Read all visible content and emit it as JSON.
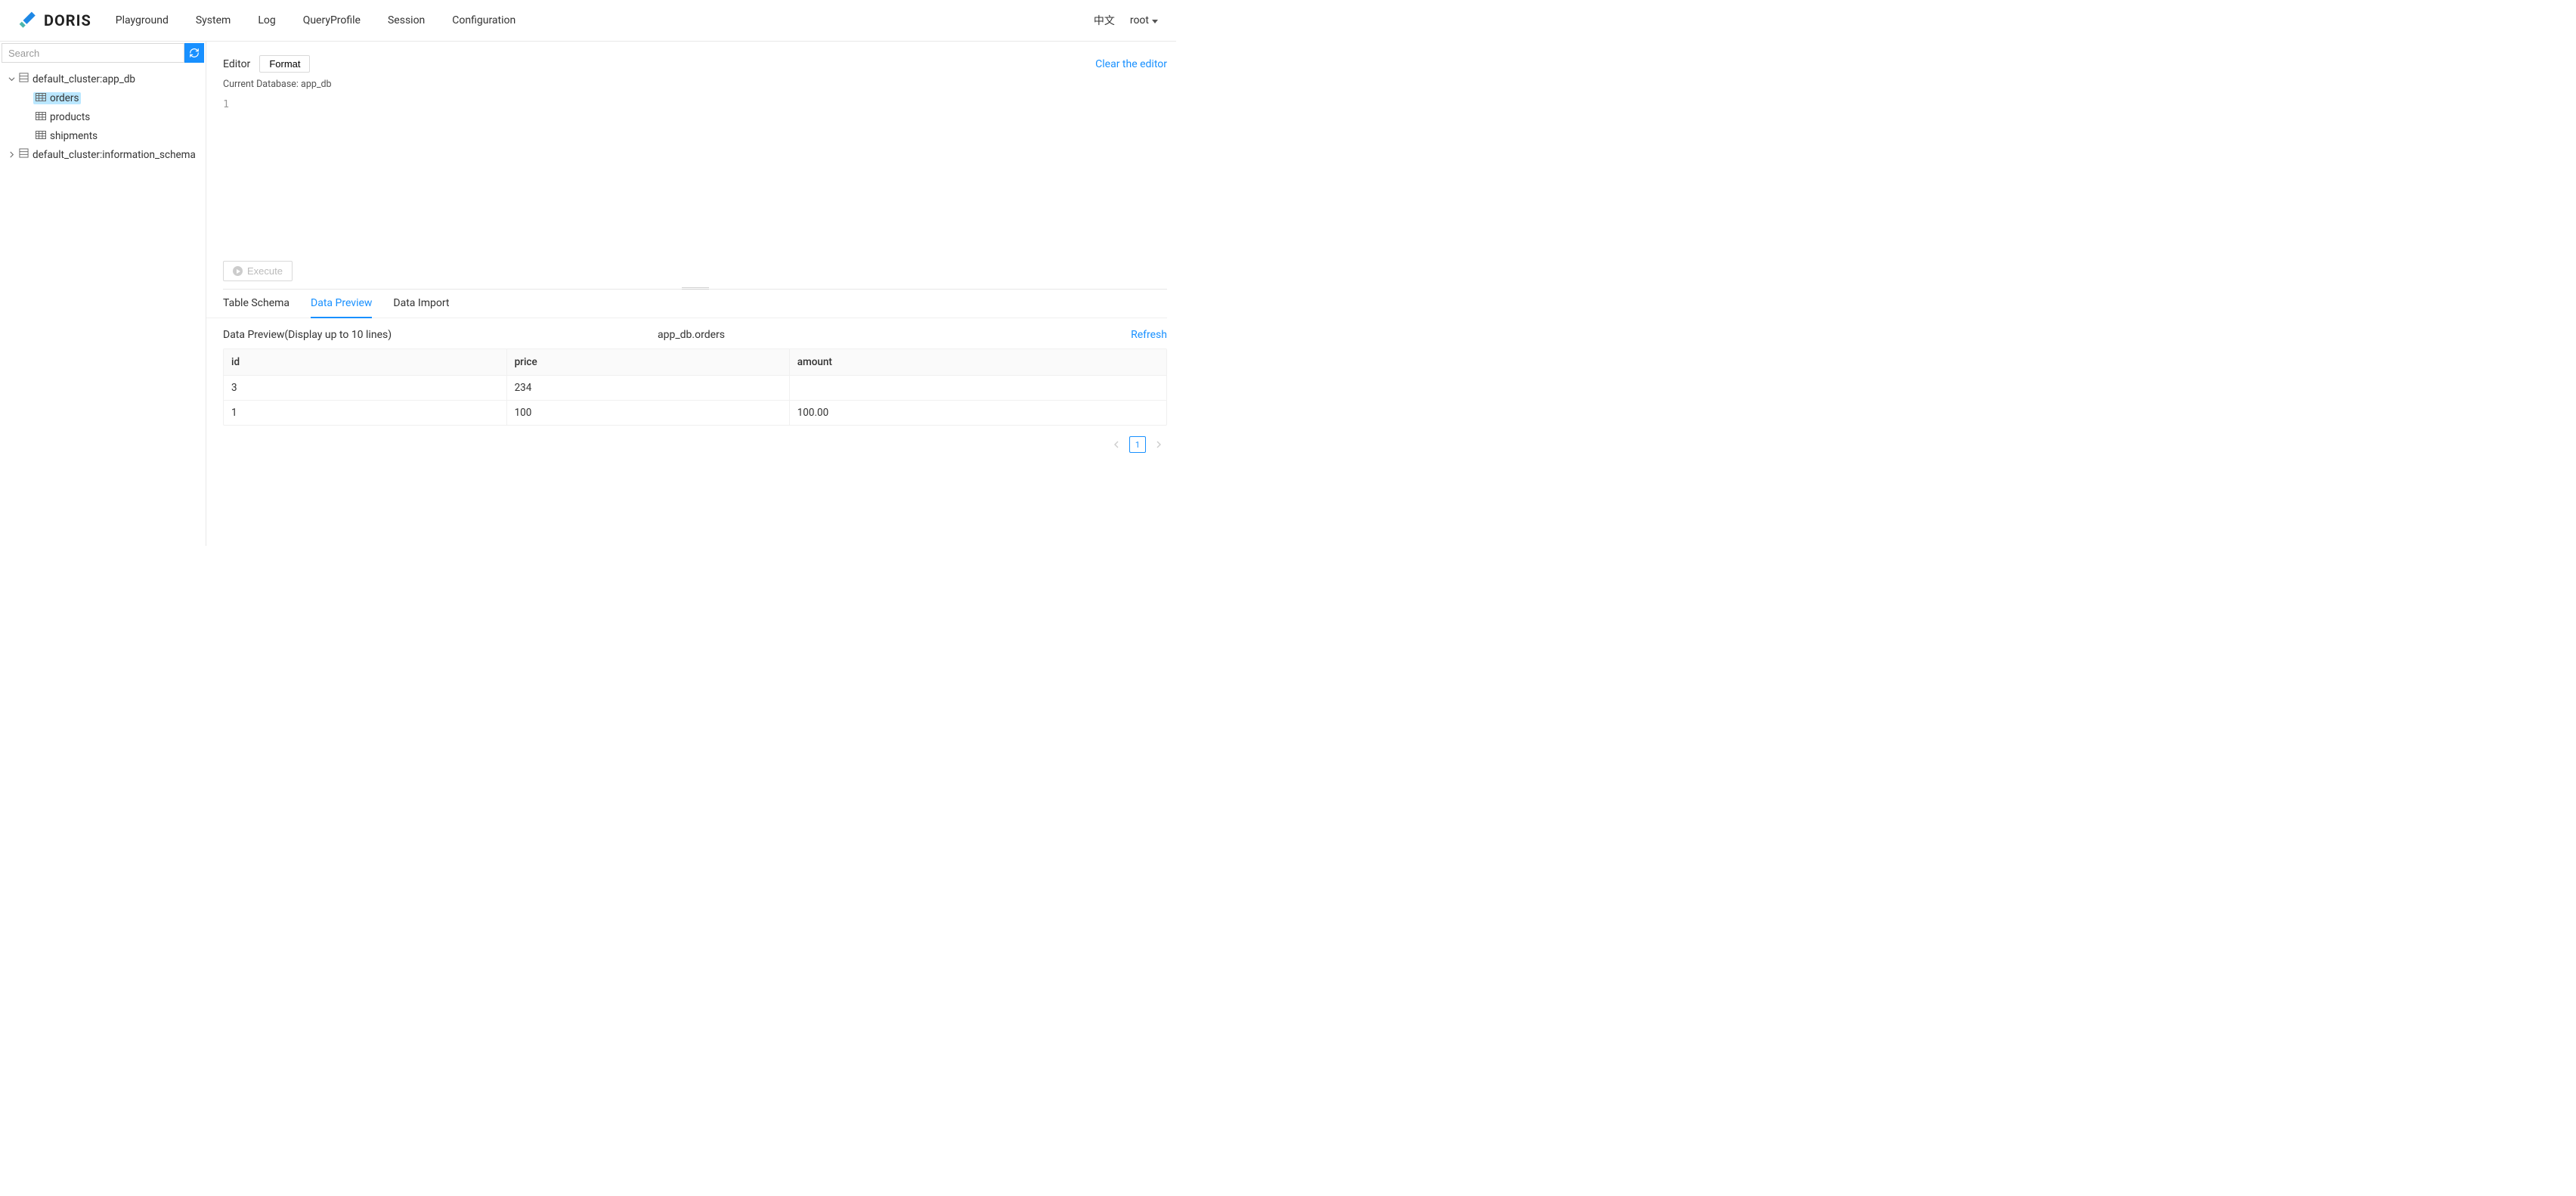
{
  "header": {
    "logo_text": "DORIS",
    "nav": [
      "Playground",
      "System",
      "Log",
      "QueryProfile",
      "Session",
      "Configuration"
    ],
    "lang": "中文",
    "user": "root"
  },
  "sidebar": {
    "search_placeholder": "Search",
    "databases": [
      {
        "name": "default_cluster:app_db",
        "expanded": true,
        "tables": [
          {
            "name": "orders",
            "selected": true
          },
          {
            "name": "products",
            "selected": false
          },
          {
            "name": "shipments",
            "selected": false
          }
        ]
      },
      {
        "name": "default_cluster:information_schema",
        "expanded": false,
        "tables": []
      }
    ]
  },
  "editor": {
    "title": "Editor",
    "format_btn": "Format",
    "clear_link": "Clear the editor",
    "current_db_label": "Current Database: app_db",
    "line_number": "1",
    "execute_btn": "Execute"
  },
  "tabs": {
    "items": [
      "Table Schema",
      "Data Preview",
      "Data Import"
    ],
    "active_index": 1
  },
  "preview": {
    "label": "Data Preview(Display up to 10 lines)",
    "table_name": "app_db.orders",
    "refresh": "Refresh",
    "columns": [
      "id",
      "price",
      "amount"
    ],
    "rows": [
      {
        "id": "3",
        "price": "234",
        "amount": ""
      },
      {
        "id": "1",
        "price": "100",
        "amount": "100.00"
      }
    ]
  },
  "pagination": {
    "current": "1"
  }
}
